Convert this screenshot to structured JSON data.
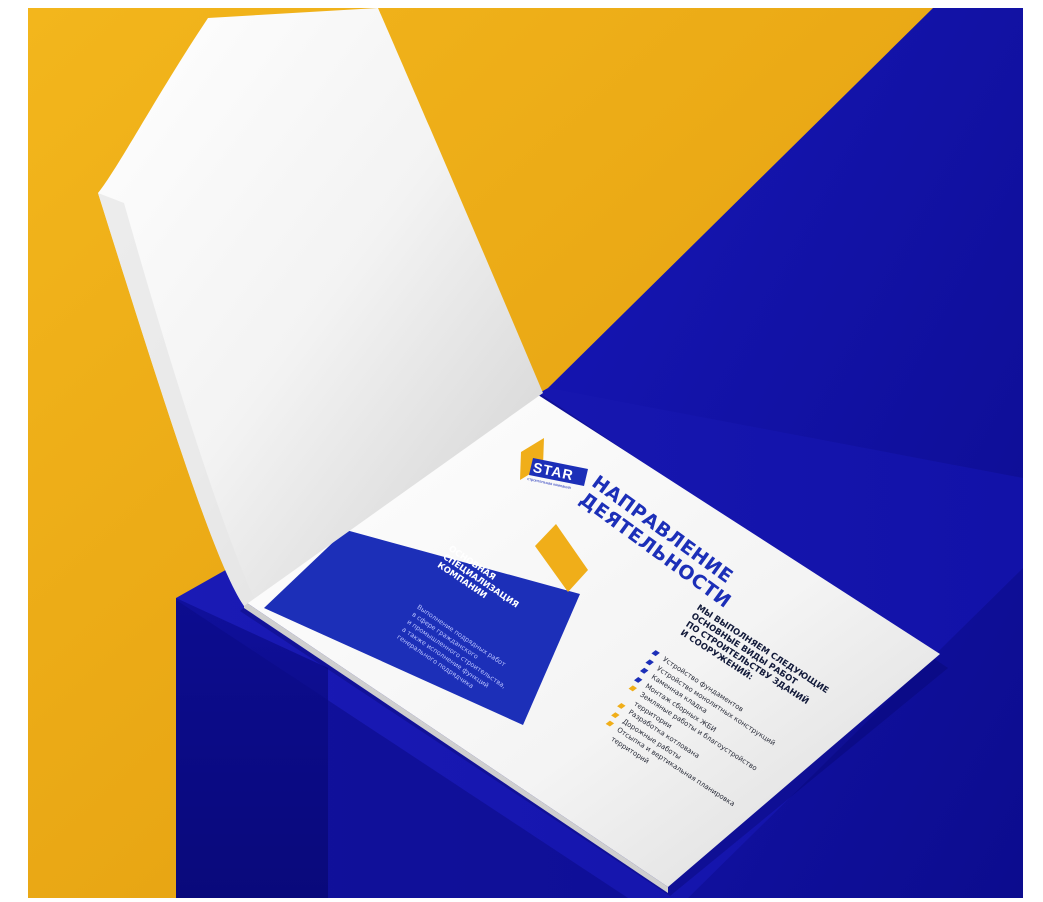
{
  "brochure": {
    "logo": {
      "text": "STAR",
      "subtitle": "строительная компания"
    },
    "title_lines": [
      "НАПРАВЛЕНИЕ",
      "ДЕЯТЕЛЬНОСТИ"
    ],
    "panel": {
      "heading_lines": [
        "ОСНОВНАЯ",
        "СПЕЦИАЛИЗАЦИЯ",
        "КОМПАНИИ"
      ],
      "body_lines": [
        "Выполнение подрядных работ",
        "в сфере гражданского",
        "и промышленного строительства,",
        "а также исполнение функций",
        "генерального подрядчика"
      ]
    },
    "works": {
      "heading_lines": [
        "МЫ ВЫПОЛНЯЕМ СЛЕДУЮЩИЕ",
        "ОСНОВНЫЕ ВИДЫ РАБОТ",
        "ПО СТРОИТЕЛЬСТВУ ЗДАНИЙ",
        "И СООРУЖЕНИЙ:"
      ],
      "items": [
        {
          "text": "Устройство фундаментов",
          "color": "#1c2fb8"
        },
        {
          "text": "Устройство монолитных конструкций",
          "color": "#1c2fb8"
        },
        {
          "text": "Каменная кладка",
          "color": "#1c2fb8"
        },
        {
          "text": "Монтаж сборных ЖБИ",
          "color": "#1c2fb8"
        },
        {
          "text": "Земляные работы и благоустройство",
          "color": "#f0ae19"
        },
        {
          "text": "территории",
          "color": ""
        },
        {
          "text": "Разработка котлована",
          "color": "#f0ae19"
        },
        {
          "text": "Дорожные работы",
          "color": "#f0ae19"
        },
        {
          "text": "Отсыпка и вертикальная планировка",
          "color": "#f0ae19"
        },
        {
          "text": "территорий",
          "color": ""
        }
      ]
    }
  },
  "colors": {
    "background_yellow": "#f0ae19",
    "background_blue": "#1414b0",
    "brand_blue": "#1c2fb8",
    "paper": "#f2f2f2"
  }
}
